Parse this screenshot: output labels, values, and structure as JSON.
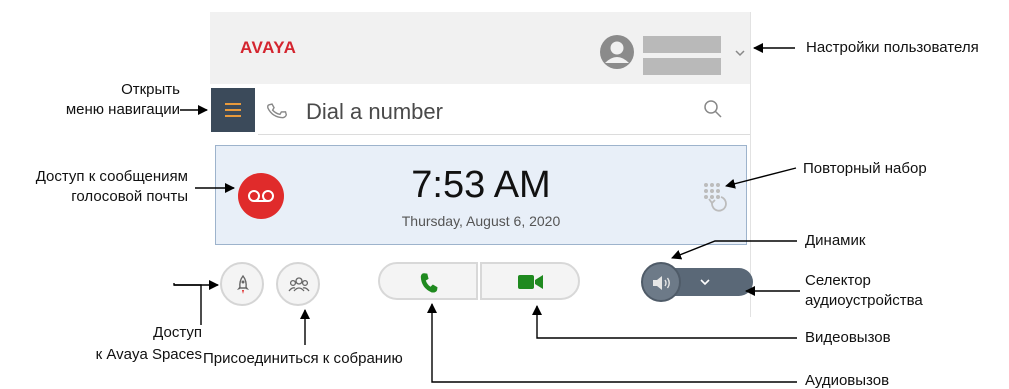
{
  "app": {
    "logo": "AVAYA",
    "dial_placeholder": "Dial a number",
    "clock_time": "7:53 AM",
    "clock_date": "Thursday, August 6, 2020"
  },
  "annotations": {
    "user_settings": "Настройки пользователя",
    "open_nav_line1": "Открыть",
    "open_nav_line2": "меню навигации",
    "voicemail_line1": "Доступ к сообщениям",
    "voicemail_line2": "голосовой почты",
    "redial": "Повторный набор",
    "speaker": "Динамик",
    "audio_selector_line1": "Селектор",
    "audio_selector_line2": "аудиоустройства",
    "spaces_line1": "Доступ",
    "spaces_line2": "к Avaya Spaces",
    "join_meeting": "Присоединиться к собранию",
    "video_call": "Видеовызов",
    "audio_call": "Аудиовызов"
  },
  "colors": {
    "brand": "#d4252f",
    "voicemail": "#e02b2b",
    "call_green": "#1f8a1f",
    "menu_bg": "#3b4a5a",
    "menu_icon": "#e89a3c",
    "panel_bg": "#e8eff8"
  },
  "icons": {
    "user": "user-circle-icon",
    "menu": "hamburger-icon",
    "phone": "phone-outline-icon",
    "search": "search-icon",
    "voicemail": "voicemail-icon",
    "redial": "redial-icon",
    "spaces": "rocket-icon",
    "meeting": "group-icon",
    "audio": "phone-icon",
    "video": "video-camera-icon",
    "speaker": "speaker-icon",
    "chevron": "chevron-down-icon"
  }
}
